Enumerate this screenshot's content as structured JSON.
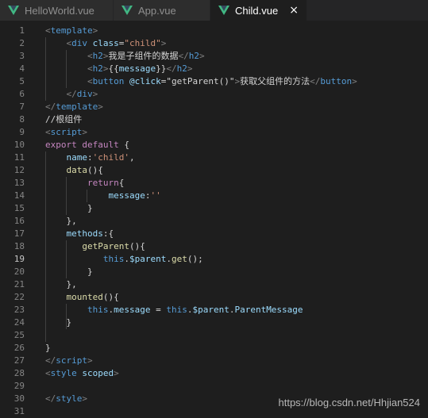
{
  "tabs": [
    {
      "label": "HelloWorld.vue",
      "active": false,
      "closable": false
    },
    {
      "label": "App.vue",
      "active": false,
      "closable": false
    },
    {
      "label": "Child.vue",
      "active": true,
      "closable": true
    }
  ],
  "close_glyph": "×",
  "current_line": 19,
  "lines": [
    {
      "n": "1",
      "tokens": [
        [
          "t-brk",
          "<"
        ],
        [
          "t-tag",
          "template"
        ],
        [
          "t-brk",
          ">"
        ]
      ]
    },
    {
      "n": "2",
      "tokens": [
        [
          "t-txt",
          "    "
        ],
        [
          "t-brk",
          "<"
        ],
        [
          "t-tag",
          "div"
        ],
        [
          "t-txt",
          " "
        ],
        [
          "t-attr",
          "class"
        ],
        [
          "t-txt",
          "="
        ],
        [
          "t-str",
          "\"child\""
        ],
        [
          "t-brk",
          ">"
        ]
      ]
    },
    {
      "n": "3",
      "tokens": [
        [
          "t-txt",
          "        "
        ],
        [
          "t-brk",
          "<"
        ],
        [
          "t-tag",
          "h2"
        ],
        [
          "t-brk",
          ">"
        ],
        [
          "t-txt",
          "我是子组件的数据"
        ],
        [
          "t-brk",
          "</"
        ],
        [
          "t-tag",
          "h2"
        ],
        [
          "t-brk",
          ">"
        ]
      ]
    },
    {
      "n": "4",
      "tokens": [
        [
          "t-txt",
          "        "
        ],
        [
          "t-brk",
          "<"
        ],
        [
          "t-tag",
          "h2"
        ],
        [
          "t-brk",
          ">"
        ],
        [
          "t-txt",
          "{{"
        ],
        [
          "t-prop",
          "message"
        ],
        [
          "t-txt",
          "}}"
        ],
        [
          "t-brk",
          "</"
        ],
        [
          "t-tag",
          "h2"
        ],
        [
          "t-brk",
          ">"
        ]
      ]
    },
    {
      "n": "5",
      "tokens": [
        [
          "t-txt",
          "        "
        ],
        [
          "t-brk",
          "<"
        ],
        [
          "t-tag",
          "button"
        ],
        [
          "t-txt",
          " "
        ],
        [
          "t-attr",
          "@click"
        ],
        [
          "t-txt",
          "="
        ],
        [
          "t-txt",
          "\"getParent()\""
        ],
        [
          "t-brk",
          ">"
        ],
        [
          "t-txt",
          "获取父组件的方法"
        ],
        [
          "t-brk",
          "</"
        ],
        [
          "t-tag",
          "button"
        ],
        [
          "t-brk",
          ">"
        ]
      ]
    },
    {
      "n": "6",
      "tokens": [
        [
          "t-txt",
          "    "
        ],
        [
          "t-brk",
          "</"
        ],
        [
          "t-tag",
          "div"
        ],
        [
          "t-brk",
          ">"
        ]
      ]
    },
    {
      "n": "7",
      "tokens": [
        [
          "t-brk",
          "</"
        ],
        [
          "t-tag",
          "template"
        ],
        [
          "t-brk",
          ">"
        ]
      ]
    },
    {
      "n": "8",
      "tokens": [
        [
          "t-cmt",
          "//根组件"
        ]
      ]
    },
    {
      "n": "9",
      "tokens": [
        [
          "t-brk",
          "<"
        ],
        [
          "t-tag",
          "script"
        ],
        [
          "t-brk",
          ">"
        ]
      ]
    },
    {
      "n": "10",
      "tokens": [
        [
          "t-kw",
          "export"
        ],
        [
          "t-txt",
          " "
        ],
        [
          "t-kw",
          "default"
        ],
        [
          "t-txt",
          " {"
        ]
      ]
    },
    {
      "n": "11",
      "tokens": [
        [
          "t-txt",
          "    "
        ],
        [
          "t-prop",
          "name"
        ],
        [
          "t-txt",
          ":"
        ],
        [
          "t-str",
          "'child'"
        ],
        [
          "t-txt",
          ","
        ]
      ]
    },
    {
      "n": "12",
      "tokens": [
        [
          "t-txt",
          "    "
        ],
        [
          "t-fn",
          "data"
        ],
        [
          "t-txt",
          "(){"
        ]
      ]
    },
    {
      "n": "13",
      "tokens": [
        [
          "t-txt",
          "        "
        ],
        [
          "t-kw",
          "return"
        ],
        [
          "t-txt",
          "{"
        ]
      ]
    },
    {
      "n": "14",
      "tokens": [
        [
          "t-txt",
          "            "
        ],
        [
          "t-prop",
          "message"
        ],
        [
          "t-txt",
          ":"
        ],
        [
          "t-str",
          "''"
        ]
      ]
    },
    {
      "n": "15",
      "tokens": [
        [
          "t-txt",
          "        }"
        ]
      ]
    },
    {
      "n": "16",
      "tokens": [
        [
          "t-txt",
          "    },"
        ]
      ]
    },
    {
      "n": "17",
      "tokens": [
        [
          "t-txt",
          "    "
        ],
        [
          "t-prop",
          "methods"
        ],
        [
          "t-txt",
          ":{"
        ]
      ]
    },
    {
      "n": "18",
      "tokens": [
        [
          "t-txt",
          "       "
        ],
        [
          "t-fn",
          "getParent"
        ],
        [
          "t-txt",
          "(){"
        ]
      ]
    },
    {
      "n": "19",
      "tokens": [
        [
          "t-txt",
          "           "
        ],
        [
          "t-kw2",
          "this"
        ],
        [
          "t-txt",
          "."
        ],
        [
          "t-prop",
          "$parent"
        ],
        [
          "t-txt",
          "."
        ],
        [
          "t-fn",
          "get"
        ],
        [
          "t-txt",
          "();"
        ]
      ]
    },
    {
      "n": "20",
      "tokens": [
        [
          "t-txt",
          "        }"
        ]
      ]
    },
    {
      "n": "21",
      "tokens": [
        [
          "t-txt",
          "    },"
        ]
      ]
    },
    {
      "n": "22",
      "tokens": [
        [
          "t-txt",
          "    "
        ],
        [
          "t-fn",
          "mounted"
        ],
        [
          "t-txt",
          "(){"
        ]
      ]
    },
    {
      "n": "23",
      "tokens": [
        [
          "t-txt",
          "        "
        ],
        [
          "t-kw2",
          "this"
        ],
        [
          "t-txt",
          "."
        ],
        [
          "t-prop",
          "message"
        ],
        [
          "t-txt",
          " = "
        ],
        [
          "t-kw2",
          "this"
        ],
        [
          "t-txt",
          "."
        ],
        [
          "t-prop",
          "$parent"
        ],
        [
          "t-txt",
          "."
        ],
        [
          "t-prop",
          "ParentMessage"
        ]
      ]
    },
    {
      "n": "24",
      "tokens": [
        [
          "t-txt",
          "    }"
        ]
      ]
    },
    {
      "n": "25",
      "tokens": []
    },
    {
      "n": "26",
      "tokens": [
        [
          "t-txt",
          "}"
        ]
      ]
    },
    {
      "n": "27",
      "tokens": [
        [
          "t-brk",
          "</"
        ],
        [
          "t-tag",
          "script"
        ],
        [
          "t-brk",
          ">"
        ]
      ]
    },
    {
      "n": "28",
      "tokens": [
        [
          "t-brk",
          "<"
        ],
        [
          "t-tag",
          "style"
        ],
        [
          "t-txt",
          " "
        ],
        [
          "t-attr",
          "scoped"
        ],
        [
          "t-brk",
          ">"
        ]
      ]
    },
    {
      "n": "29",
      "tokens": []
    },
    {
      "n": "30",
      "tokens": [
        [
          "t-brk",
          "</"
        ],
        [
          "t-tag",
          "style"
        ],
        [
          "t-brk",
          ">"
        ]
      ]
    },
    {
      "n": "31",
      "tokens": []
    }
  ],
  "watermark": "https://blog.csdn.net/Hhjian524"
}
